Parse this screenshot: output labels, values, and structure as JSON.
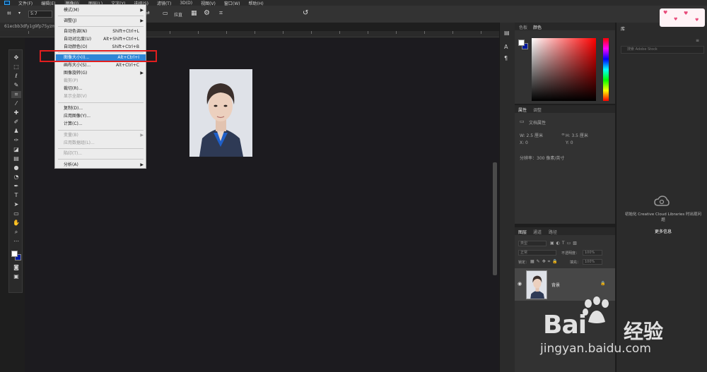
{
  "menubar": {
    "items": [
      "文件(F)",
      "编辑(E)",
      "图像(I)",
      "图层(L)",
      "文字(Y)",
      "选择(S)",
      "滤镜(T)",
      "3D(D)",
      "视图(V)",
      "窗口(W)",
      "帮助(H)"
    ]
  },
  "options": {
    "ratio_value": "5:7",
    "clear_label": "拉直"
  },
  "document": {
    "tab_name": "61ecbb3dfy1g9fp75yzmk"
  },
  "image_menu": {
    "mode": {
      "label": "模式(M)"
    },
    "adjustments": {
      "label": "调整(J)"
    },
    "auto_tone": {
      "label": "自动色调(N)",
      "shortcut": "Shift+Ctrl+L"
    },
    "auto_contrast": {
      "label": "自动对比度(U)",
      "shortcut": "Alt+Shift+Ctrl+L"
    },
    "auto_color": {
      "label": "自动颜色(O)",
      "shortcut": "Shift+Ctrl+B"
    },
    "image_size": {
      "label": "图像大小(I)...",
      "shortcut": "Alt+Ctrl+I"
    },
    "canvas_size": {
      "label": "画布大小(S)...",
      "shortcut": "Alt+Ctrl+C"
    },
    "image_rotation": {
      "label": "图像旋转(G)"
    },
    "crop": {
      "label": "裁剪(P)"
    },
    "trim": {
      "label": "裁切(R)..."
    },
    "reveal_all": {
      "label": "显示全部(V)"
    },
    "duplicate": {
      "label": "复制(D)..."
    },
    "apply_image": {
      "label": "应用图像(Y)..."
    },
    "calculations": {
      "label": "计算(C)..."
    },
    "variables": {
      "label": "变量(B)"
    },
    "apply_data_set": {
      "label": "应用数据组(L)..."
    },
    "trap": {
      "label": "陷印(T)..."
    },
    "analysis": {
      "label": "分析(A)"
    }
  },
  "color_panel": {
    "tabs": [
      "色板",
      "颜色"
    ]
  },
  "properties_panel": {
    "tabs": [
      "属性",
      "调整"
    ],
    "doc_props": "文档属性",
    "w": "W:  2.5 厘米",
    "h": "H:  3.5 厘米",
    "x": "X:  0",
    "y": "Y:  0",
    "resolution": "分辨率：300 像素/英寸"
  },
  "layers_panel": {
    "tabs": [
      "图层",
      "通道",
      "路径"
    ],
    "kind_placeholder": "类型",
    "blend_mode": "正常",
    "opacity_label": "不透明度：",
    "opacity_value": "100%",
    "lock_label": "锁定：",
    "fill_label": "填充：",
    "fill_value": "100%",
    "layer_name": "背景"
  },
  "libraries": {
    "tab": "库",
    "search_placeholder": "搜索 Adobe Stock",
    "message": "初始化 Creative Cloud Libraries 时出现问题",
    "more_info": "更多信息"
  },
  "watermark": {
    "brand": "Bai",
    "brand2": "经验",
    "url": "jingyan.baidu.com"
  },
  "colors": {
    "highlight": "#2f86d6",
    "annotation_red": "#e01e1e",
    "canvas_bg": "#1c1b1f"
  }
}
